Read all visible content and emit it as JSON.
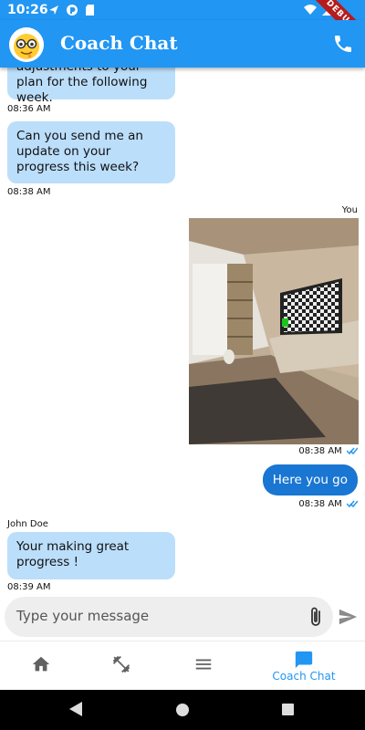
{
  "status_bar": {
    "time": "10:26",
    "debug_label": "DEBUG",
    "icons": [
      "navigation-icon",
      "circle-app-icon",
      "sd-card-icon",
      "wifi-icon",
      "signal-icon",
      "battery-icon"
    ]
  },
  "app_bar": {
    "title": "Coach Chat",
    "avatar_icon": "nerd-face-emoji",
    "call_icon": "phone-icon",
    "color": "#2196F3"
  },
  "messages": [
    {
      "direction": "incoming",
      "text": "adjustments to your plan for the following week.",
      "time": "08:36 AM"
    },
    {
      "direction": "incoming",
      "text": "Can you send me an update on your progress this week?",
      "time": "08:38 AM"
    },
    {
      "direction": "outgoing",
      "sender": "You",
      "type": "image",
      "image_icon": "living-room-photo",
      "time": "08:38 AM"
    },
    {
      "direction": "outgoing",
      "text": "Here you go",
      "time": "08:38 AM"
    },
    {
      "direction": "incoming",
      "sender": "John Doe",
      "text": "Your making great progress !",
      "time": "08:39 AM"
    }
  ],
  "composer": {
    "placeholder": "Type your message",
    "attach_icon": "paperclip-icon",
    "send_icon": "send-icon"
  },
  "bottom_nav": {
    "items": [
      {
        "icon": "home-icon",
        "label": ""
      },
      {
        "icon": "dumbbell-icon",
        "label": ""
      },
      {
        "icon": "menu-icon",
        "label": ""
      },
      {
        "icon": "chat-icon",
        "label": "Coach Chat",
        "active": true
      }
    ],
    "active_color": "#2196F3"
  },
  "colors": {
    "incoming_bubble": "#BBDEFB",
    "outgoing_bubble": "#1976D2",
    "read_tick": "#2196F3"
  }
}
